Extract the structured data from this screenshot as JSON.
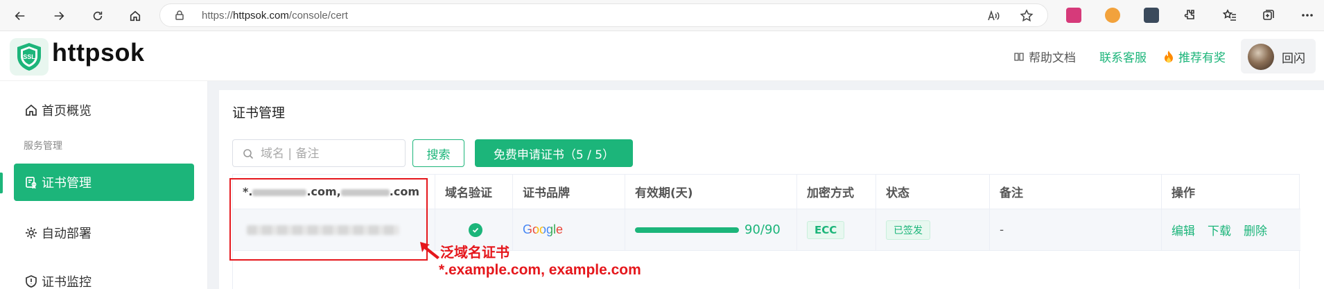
{
  "browser": {
    "url_protocol": "https://",
    "url_host": "httpsok.com",
    "url_path": "/console/cert"
  },
  "header": {
    "brand": "httpsok",
    "logo_text": "SSL",
    "help_docs": "帮助文档",
    "contact_support": "联系客服",
    "referral": "推荐有奖",
    "user_name": "回闪"
  },
  "sidebar": {
    "items": [
      {
        "label": "首页概览",
        "icon": "home-icon"
      },
      {
        "label": "证书管理",
        "icon": "certificate-icon",
        "active": true
      },
      {
        "label": "自动部署",
        "icon": "deploy-icon"
      },
      {
        "label": "证书监控",
        "icon": "shield-icon"
      }
    ],
    "group_label": "服务管理"
  },
  "main": {
    "title": "证书管理",
    "search_placeholder": "域名 | 备注",
    "search_button": "搜索",
    "apply_button": "免费申请证书（5 / 5）"
  },
  "table": {
    "headers": [
      "*.",
      "域名验证",
      "证书品牌",
      "有效期(天)",
      "加密方式",
      "状态",
      "备注",
      "操作"
    ],
    "domain_header_parts": [
      "*.",
      ".com,",
      ".com"
    ],
    "row": {
      "brand": "Google",
      "validity": "90/90",
      "validity_fraction": 1.0,
      "encryption": "ECC",
      "status": "已签发",
      "note": "-",
      "actions": [
        "编辑",
        "下载",
        "删除"
      ]
    }
  },
  "annotation": {
    "label": "泛域名证书",
    "example": "*.example.com, example.com",
    "color": "#e5171c"
  },
  "colors": {
    "accent": "#1cb57a",
    "annotation": "#e5171c"
  }
}
